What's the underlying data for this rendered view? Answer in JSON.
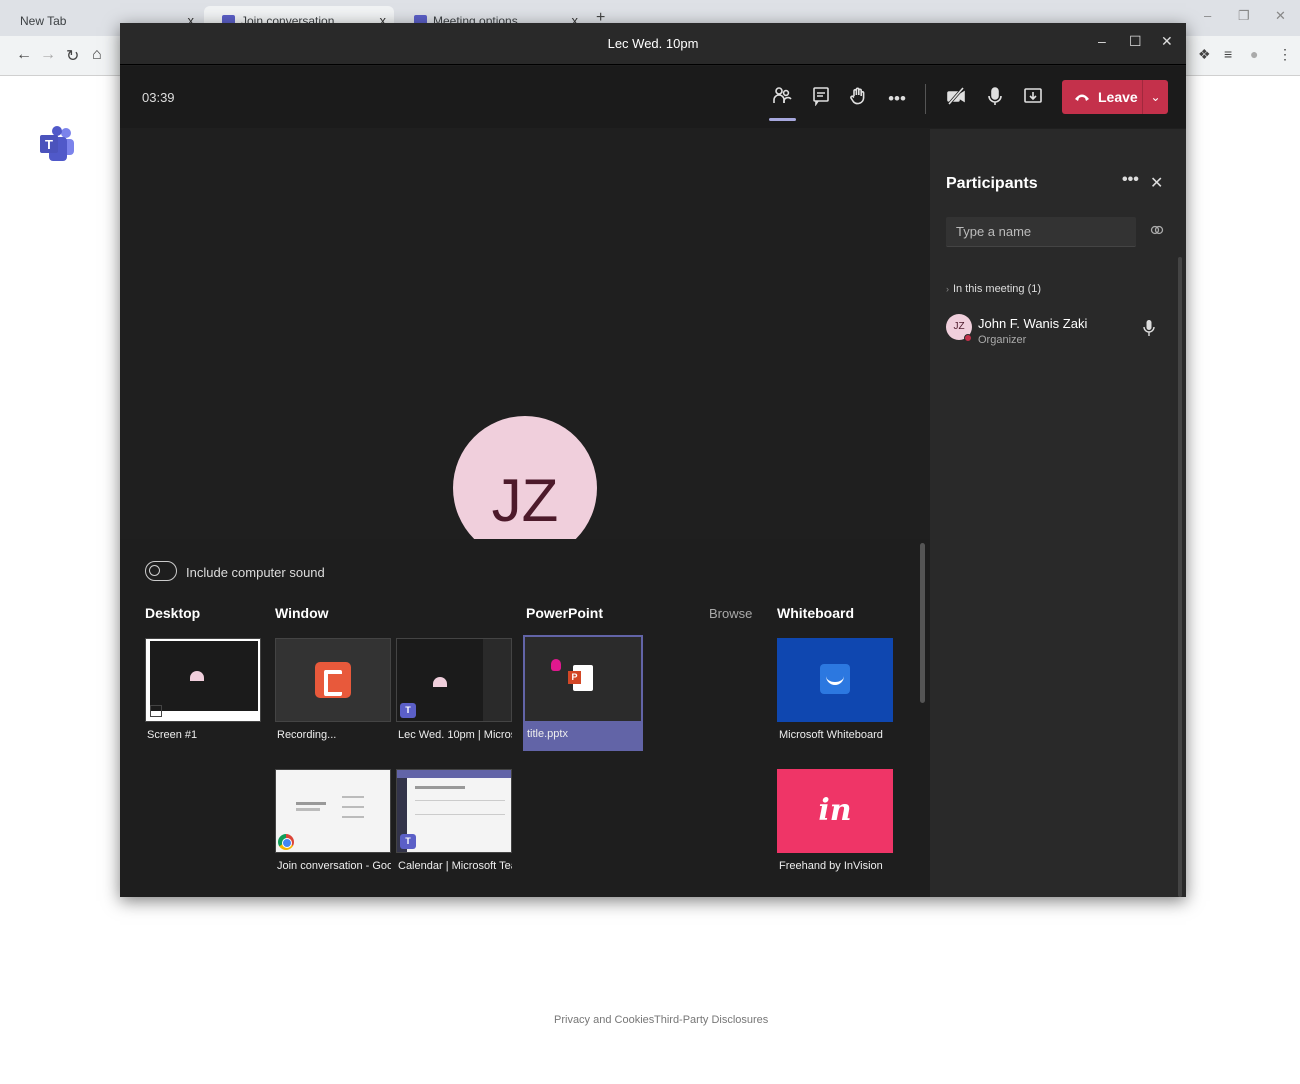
{
  "browser": {
    "tabs": [
      {
        "label": "New Tab"
      },
      {
        "label": "Join conversation"
      },
      {
        "label": "Meeting options"
      }
    ],
    "tab_close": "x",
    "new_tab": "+"
  },
  "window": {
    "title": "Lec Wed. 10pm"
  },
  "toolbar": {
    "timer": "03:39",
    "leave_label": "Leave"
  },
  "stage": {
    "avatar_initials": "JZ"
  },
  "share_tray": {
    "include_sound_label": "Include computer sound",
    "include_sound_on": false,
    "sections": {
      "desktop": "Desktop",
      "window": "Window",
      "powerpoint": "PowerPoint",
      "browse": "Browse",
      "whiteboard": "Whiteboard"
    },
    "desktop_items": [
      {
        "label": "Screen #1"
      }
    ],
    "window_items": [
      {
        "label": "Recording..."
      },
      {
        "label": "Lec Wed. 10pm | Micros..."
      },
      {
        "label": "Join conversation - Goo..."
      },
      {
        "label": "Calendar | Microsoft Tea..."
      }
    ],
    "powerpoint_items": [
      {
        "label": "title.pptx",
        "selected": true
      }
    ],
    "whiteboard_items": [
      {
        "label": "Microsoft Whiteboard"
      },
      {
        "label": "Freehand by InVision",
        "logo_text": "in"
      }
    ]
  },
  "participants": {
    "title": "Participants",
    "search_placeholder": "Type a name",
    "section_label": "In this meeting (1)",
    "people": [
      {
        "initials": "JZ",
        "name": "John F. Wanis Zaki",
        "role": "Organizer"
      }
    ]
  },
  "footer": {
    "privacy": "Privacy and Cookies",
    "third_party": "Third-Party Disclosures"
  },
  "colors": {
    "leave_red": "#c4314b",
    "accent_purple": "#6264a7",
    "avatar_pink": "#f0cfdc"
  }
}
